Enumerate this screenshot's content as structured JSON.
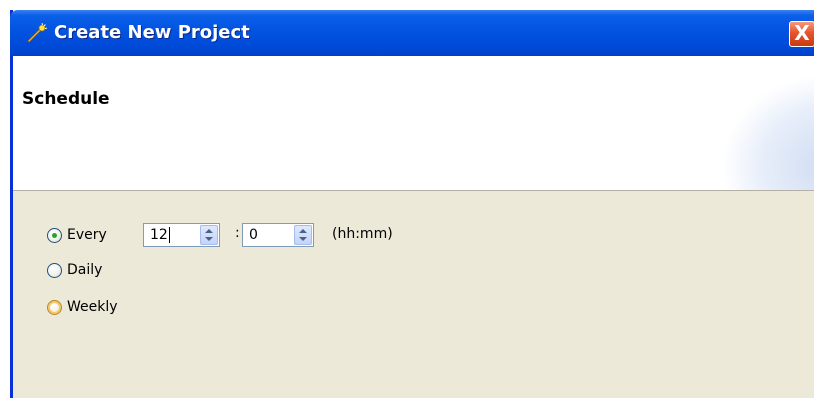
{
  "window": {
    "title": "Create New Project",
    "close_label": "X"
  },
  "header": {
    "section_title": "Schedule"
  },
  "schedule": {
    "options": [
      {
        "label": "Every",
        "selected": true
      },
      {
        "label": "Daily",
        "selected": false
      },
      {
        "label": "Weekly",
        "selected": false
      }
    ],
    "hours_value": "12",
    "minutes_value": "0",
    "separator": ":",
    "units_label": "(hh:mm)"
  },
  "icons": {
    "title_icon": "magic-wand-icon",
    "spin_up": "arrow-up-icon",
    "spin_down": "arrow-down-icon"
  },
  "colors": {
    "titlebar": "#0252e0",
    "close_button": "#e5542c",
    "dialog_background": "#ece9d8",
    "radio_checked_dot": "#27a327"
  }
}
